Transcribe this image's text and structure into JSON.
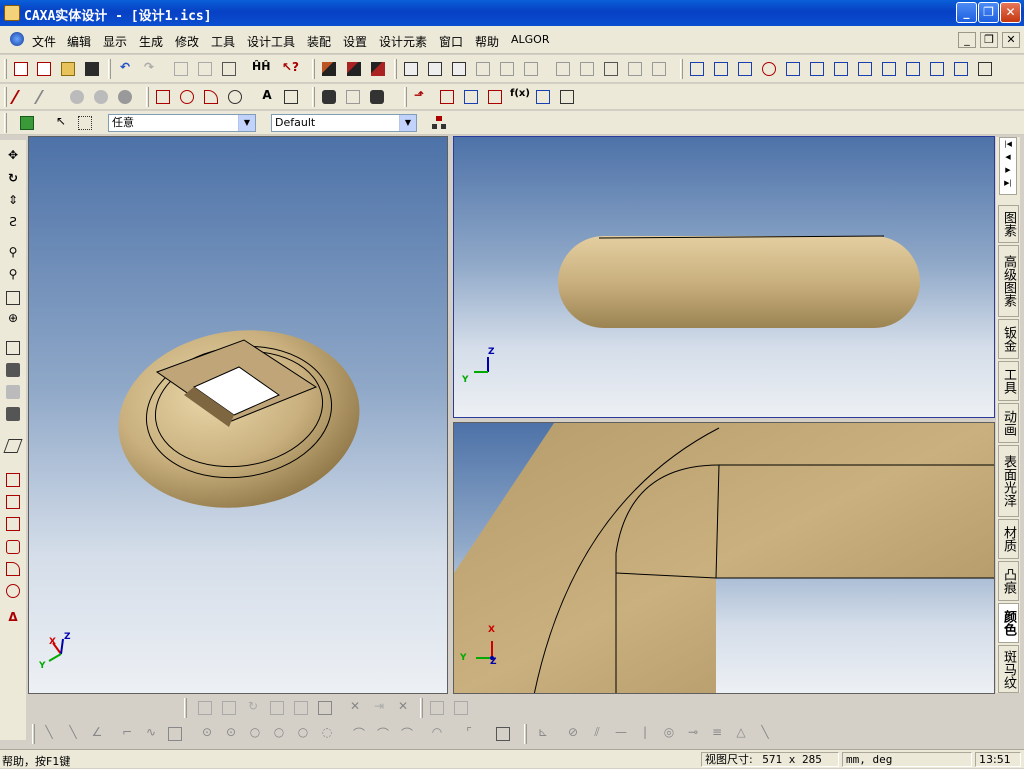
{
  "window": {
    "title": "CAXA实体设计 - [设计1.ics]",
    "controls": {
      "minimize": "_",
      "restore": "❐",
      "close": "✕"
    }
  },
  "menu": {
    "items": [
      "文件",
      "编辑",
      "显示",
      "生成",
      "修改",
      "工具",
      "设计工具",
      "装配",
      "设置",
      "设计元素",
      "窗口",
      "帮助",
      "ALGOR"
    ],
    "mdi": {
      "minimize": "_",
      "restore": "❐",
      "close": "✕"
    }
  },
  "toolbar3": {
    "select_filter": "任意",
    "style_select": "Default"
  },
  "viewports": {
    "iso": {
      "axes": {
        "x": "X",
        "y": "Y",
        "z": "Z"
      }
    },
    "front": {
      "axes": {
        "y": "Y",
        "z": "Z"
      }
    },
    "detail": {
      "axes": {
        "x": "X",
        "y": "Y",
        "z": "Z"
      }
    }
  },
  "right_panel": {
    "nav": [
      "|◀",
      "◀",
      "▶",
      "▶|"
    ],
    "tabs": [
      "图素",
      "高级图素",
      "钣金",
      "工具",
      "动画",
      "表面光泽",
      "材质",
      "凸痕",
      "颜色",
      "斑马纹"
    ],
    "active_tab": "颜色"
  },
  "status": {
    "help": "帮助，按F1键",
    "view_size_label": "视图尺寸:",
    "view_size_value": "571 x  285",
    "units": "mm, deg",
    "time": "13:51"
  },
  "colors": {
    "titlebar": "#0a5fd8",
    "model": "#c9b07e",
    "viewport_top": "#4d72a8",
    "viewport_bottom": "#edf0f4"
  }
}
